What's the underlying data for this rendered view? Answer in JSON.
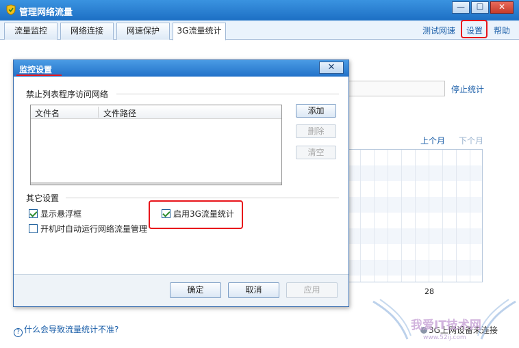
{
  "window": {
    "title": "管理网络流量",
    "controls": [
      "—",
      "☐",
      "✕"
    ]
  },
  "tabs": [
    {
      "label": "流量监控"
    },
    {
      "label": "网络连接"
    },
    {
      "label": "网速保护"
    },
    {
      "label": "3G流量统计"
    }
  ],
  "top_links": {
    "test_speed": "测试网速",
    "settings": "设置",
    "help": "帮助"
  },
  "background": {
    "stop_stat": "停止统计",
    "prev_month": "上个月",
    "next_month": "下个月",
    "chart_tick": "28",
    "help_question": "什么会导致流量统计不准?",
    "connection_status": "3G上网设备未连接",
    "watermark_text": "我爱IT技术网",
    "watermark_url": "www.52ij.com"
  },
  "dialog": {
    "title": "监控设置",
    "close": "✕",
    "blocked_section": "禁止列表程序访问网络",
    "columns": [
      "文件名",
      "文件路径"
    ],
    "buttons": {
      "add": "添加",
      "delete": "删除",
      "clear": "清空"
    },
    "other_section": "其它设置",
    "options": {
      "show_float": {
        "label": "显示悬浮框",
        "checked": true
      },
      "autostart": {
        "label": "开机时自动运行网络流量管理",
        "checked": false
      },
      "enable_3g": {
        "label": "启用3G流量统计",
        "checked": true
      }
    },
    "footer": {
      "ok": "确定",
      "cancel": "取消",
      "apply": "应用"
    }
  },
  "colors": {
    "titlebar": "#1d6fc4",
    "highlight": "#e8141a",
    "link": "#1a5ea8"
  }
}
